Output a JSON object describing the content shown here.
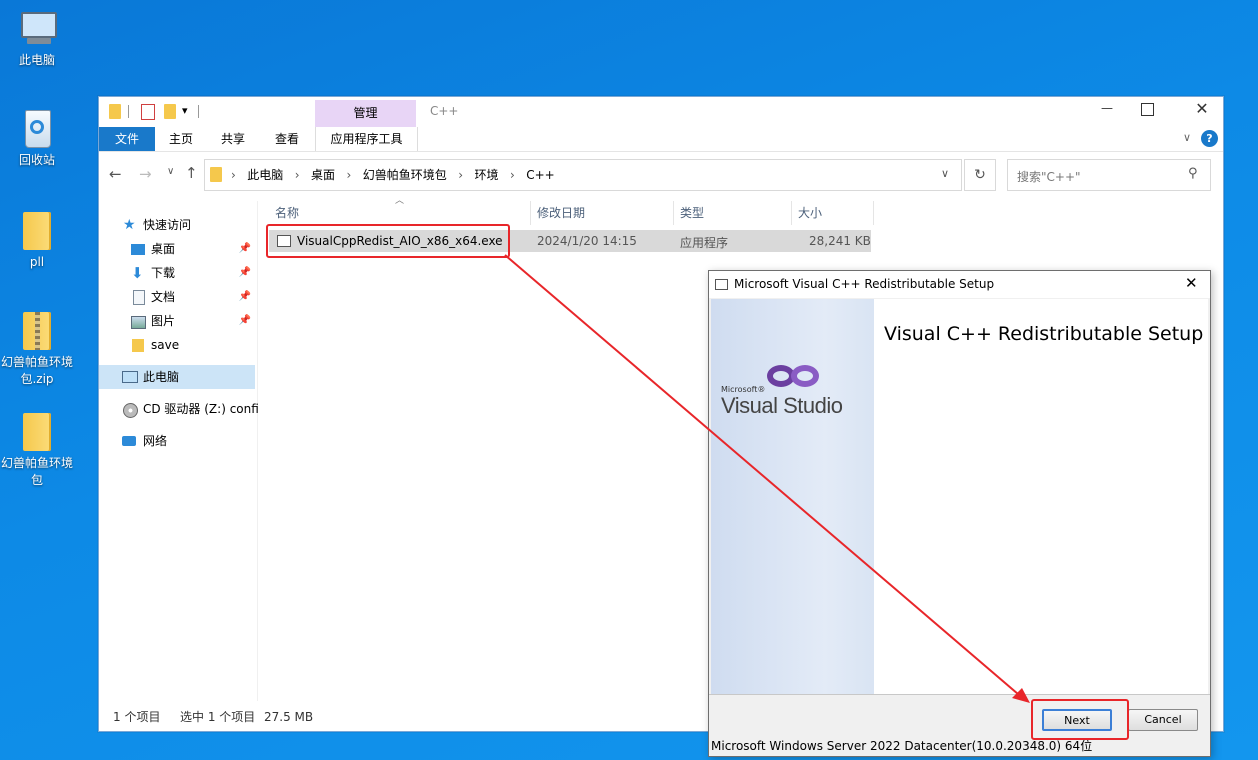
{
  "desktop": {
    "icons": [
      {
        "label": "此电脑",
        "icon": "computer-icon"
      },
      {
        "label": "回收站",
        "icon": "recycle-bin-icon"
      },
      {
        "label": "pll",
        "icon": "folder-icon"
      },
      {
        "label": "幻兽帕鱼环境包.zip",
        "icon": "zip-folder-icon"
      },
      {
        "label": "幻兽帕鱼环境包",
        "icon": "folder-icon"
      }
    ]
  },
  "explorer": {
    "title": "C++",
    "context_tab_group": "管理",
    "tabs": [
      "文件",
      "主页",
      "共享",
      "查看",
      "应用程序工具"
    ],
    "accent": "#1979ca",
    "context_tab_color": "#e8d5f6",
    "breadcrumb": [
      "此电脑",
      "桌面",
      "幻兽帕鱼环境包",
      "环境",
      "C++"
    ],
    "search_placeholder": "搜索\"C++\"",
    "nav": {
      "quick_access": "快速访问",
      "items": [
        {
          "label": "桌面",
          "pinned": true
        },
        {
          "label": "下载",
          "pinned": true
        },
        {
          "label": "文档",
          "pinned": true
        },
        {
          "label": "图片",
          "pinned": true
        },
        {
          "label": "save",
          "pinned": false
        }
      ],
      "this_pc": "此电脑",
      "cd_drive": "CD 驱动器 (Z:) confi",
      "network": "网络"
    },
    "columns": [
      "名称",
      "修改日期",
      "类型",
      "大小"
    ],
    "files": [
      {
        "name": "VisualCppRedist_AIO_x86_x64.exe",
        "modified": "2024/1/20 14:15",
        "type": "应用程序",
        "size": "28,241 KB"
      }
    ],
    "status": {
      "count": "1 个项目",
      "selected": "选中 1 个项目",
      "size": "27.5 MB"
    }
  },
  "setup": {
    "title": "Microsoft Visual C++ Redistributable Setup",
    "heading": "Visual C++ Redistributable Setup",
    "brand_small": "Microsoft®",
    "brand": "Visual Studio",
    "next_label": "Next",
    "cancel_label": "Cancel"
  },
  "os_watermark": "Microsoft Windows Server 2022 Datacenter(10.0.20348.0) 64位",
  "annotation_color": "#e8262a"
}
